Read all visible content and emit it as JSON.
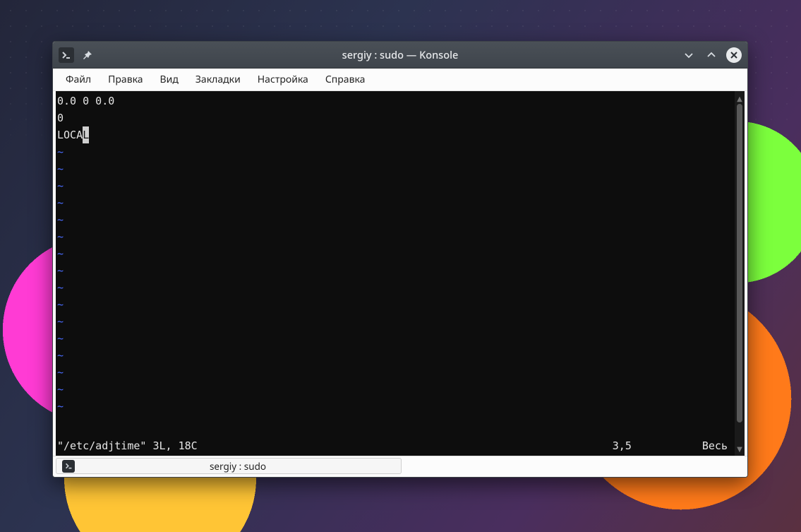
{
  "window": {
    "title": "sergiy : sudo — Konsole"
  },
  "menubar": {
    "items": [
      {
        "label": "Файл"
      },
      {
        "label": "Правка"
      },
      {
        "label": "Вид"
      },
      {
        "label": "Закладки"
      },
      {
        "label": "Настройка"
      },
      {
        "label": "Справка"
      }
    ]
  },
  "terminal": {
    "content_lines": [
      "0.0 0 0.0",
      "0",
      "LOCAL"
    ],
    "cursor": {
      "line_index": 2,
      "before": "LOCA",
      "under": "L",
      "after": ""
    },
    "tilde_char": "~",
    "tilde_rows": 16,
    "statusline": {
      "left": "\"/etc/adjtime\" 3L, 18C",
      "position": "3,5",
      "percent": "Весь"
    }
  },
  "tabs": [
    {
      "label": "sergiy : sudo"
    }
  ],
  "icons": {
    "app_glyph": ">_",
    "pin_title": "pin",
    "minimize_title": "minimize",
    "maximize_title": "maximize",
    "close_title": "close"
  }
}
